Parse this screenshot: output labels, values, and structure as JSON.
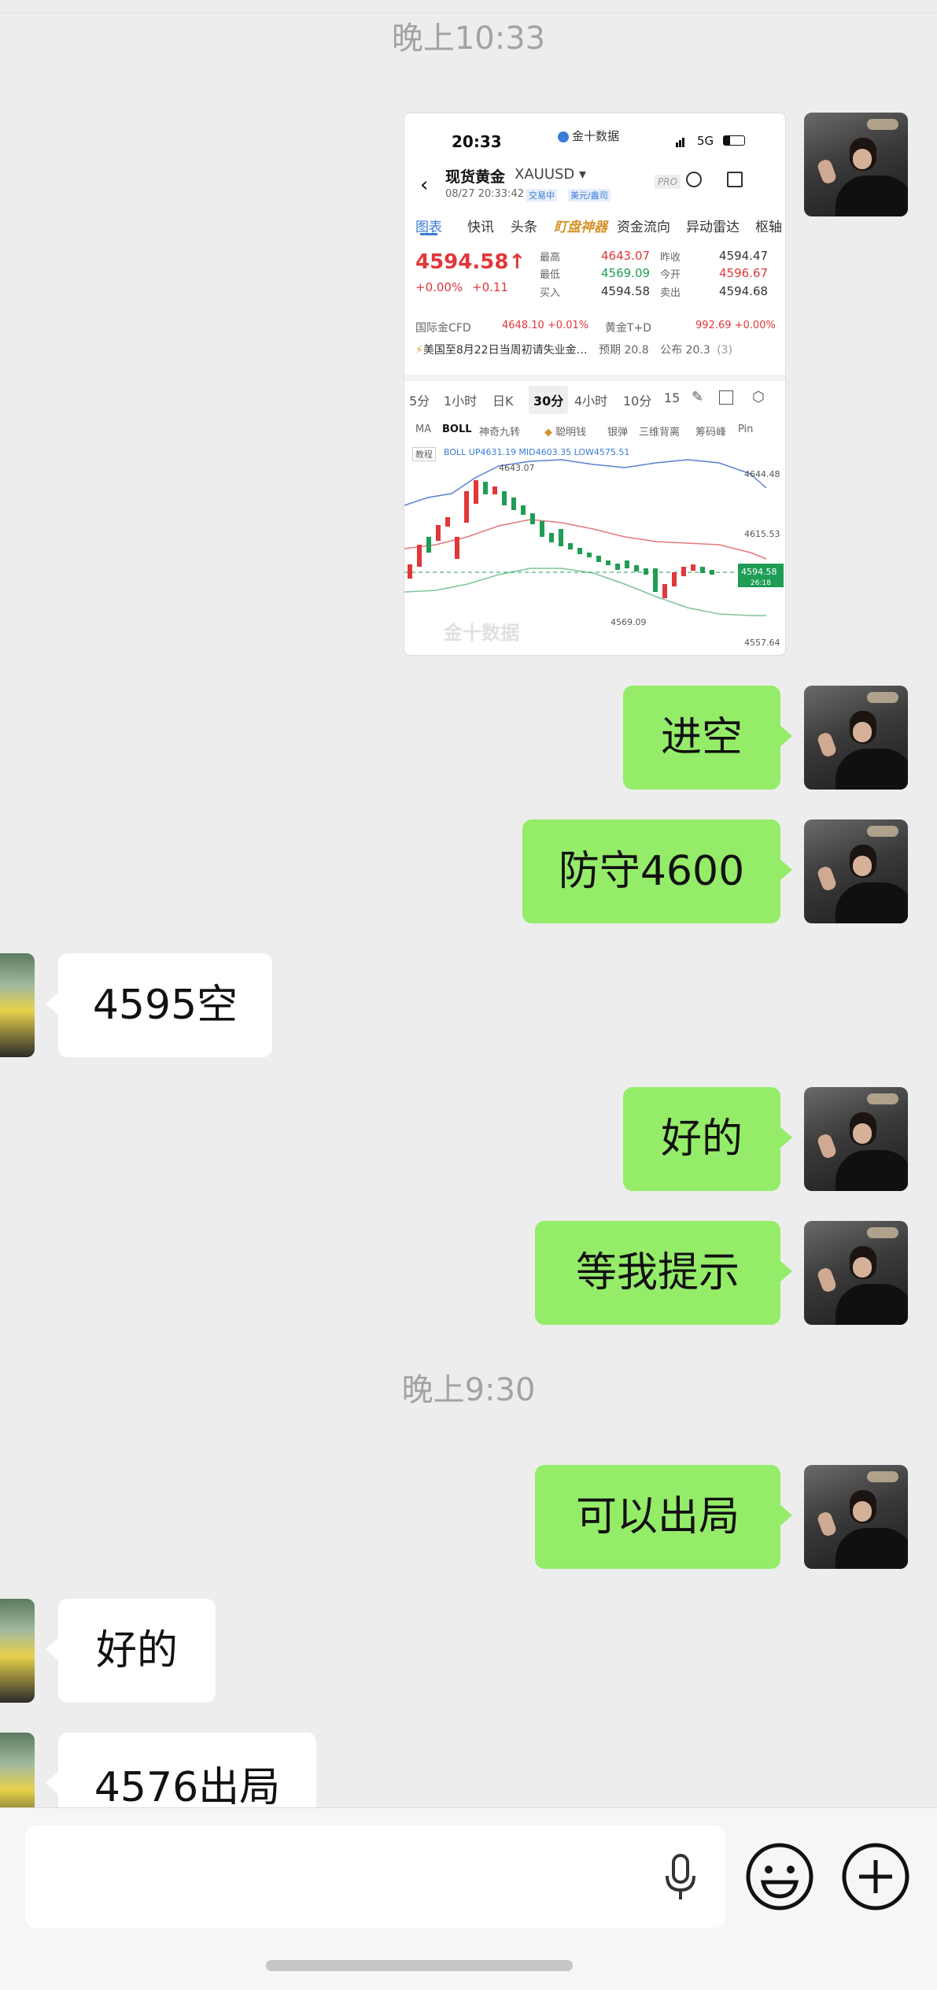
{
  "chat": {
    "timestamp_1": "晚上10:33",
    "timestamp_2": "晚上9:30"
  },
  "shot": {
    "status_time": "20:33",
    "app_badge": "金十数据",
    "network": "5G",
    "title": "现货黄金",
    "symbol": "XAUUSD",
    "datetime": "08/27 20:33:42",
    "trading_status": "交易中",
    "unit": "美元/盎司",
    "pro": "PRO",
    "tabs": [
      "图表",
      "快讯",
      "头条",
      "盯盘神器",
      "资金流向",
      "异动雷达",
      "枢轴"
    ],
    "price": "4594.58",
    "change_pct": "+0.00%",
    "change": "+0.11",
    "stats": {
      "high_label": "最高",
      "high": "4643.07",
      "low_label": "最低",
      "low": "4569.09",
      "buy_label": "买入",
      "buy": "4594.58",
      "prev_label": "昨收",
      "prev": "4594.47",
      "open_label": "今开",
      "open": "4596.67",
      "sell_label": "卖出",
      "sell": "4594.68"
    },
    "cfd_label": "国际金CFD",
    "cfd_value": "4648.10",
    "cfd_pct": "+0.01%",
    "td_label": "黄金T+D",
    "td_value": "992.69",
    "td_pct": "+0.00%",
    "news": "美国至8月22日当周初请失业金…",
    "forecast": "预期 20.8",
    "actual": "公布 20.3",
    "news_count": "(3)",
    "periods": [
      "5分",
      "1小时",
      "日K",
      "30分",
      "4小时",
      "10分",
      "15"
    ],
    "indicators": [
      "MA",
      "BOLL",
      "神奇九转",
      "聪明钱",
      "银弹",
      "三维背离",
      "筹码峰",
      "Pin"
    ],
    "tutorial": "教程",
    "boll": "BOLL UP4631.19 MID4603.35 LOW4575.51",
    "chart_high_label": "4643.07",
    "chart_low_label": "4569.09",
    "axis_top": "4644.48",
    "axis_mid": "4615.53",
    "axis_bottom": "4557.64",
    "current_tag": "4594.58",
    "current_sub": "26:18",
    "watermark": "金十数据"
  },
  "messages": [
    {
      "side": "me",
      "text": "进空"
    },
    {
      "side": "me",
      "text": "防守4600"
    },
    {
      "side": "other",
      "text": "4595空"
    },
    {
      "side": "me",
      "text": "好的"
    },
    {
      "side": "me",
      "text": "等我提示"
    },
    {
      "side": "me",
      "text": "可以出局"
    },
    {
      "side": "other",
      "text": "好的"
    },
    {
      "side": "other",
      "text": "4576出局"
    }
  ],
  "input": {
    "voice_icon": "microphone-icon",
    "emoji_icon": "emoji-icon",
    "plus_icon": "plus-icon"
  }
}
